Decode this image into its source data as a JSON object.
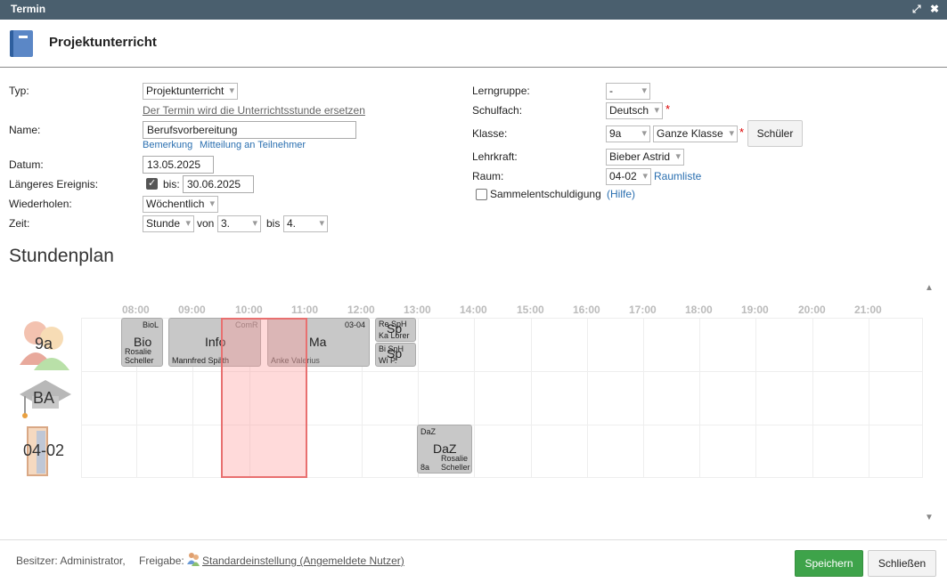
{
  "window": {
    "title": "Termin"
  },
  "header": {
    "title": "Projektunterricht"
  },
  "form": {
    "typ_label": "Typ:",
    "typ_value": "Projektunterricht",
    "typ_note": "Der Termin wird die Unterrichtsstunde ersetzen",
    "name_label": "Name:",
    "name_value": "Berufsvorbereitung",
    "bemerkung_link": "Bemerkung",
    "mitteilung_link": "Mitteilung an Teilnehmer",
    "datum_label": "Datum:",
    "datum_value": "13.05.2025",
    "laenger_label": "Längeres Ereignis:",
    "bis_label": "bis:",
    "bis_value": "30.06.2025",
    "wiederholen_label": "Wiederholen:",
    "wiederholen_value": "Wöchentlich",
    "zeit_label": "Zeit:",
    "zeit_unit": "Stunde",
    "von_label": "von",
    "von_value": "3.",
    "bis2_label": "bis",
    "bis2_value": "4.",
    "lerngruppe_label": "Lerngruppe:",
    "lerngruppe_value": "-",
    "schulfach_label": "Schulfach:",
    "schulfach_value": "Deutsch",
    "klasse_label": "Klasse:",
    "klasse_value": "9a",
    "klasse_scope": "Ganze Klasse",
    "schueler_button": "Schüler",
    "lehrkraft_label": "Lehrkraft:",
    "lehrkraft_value": "Bieber Astrid",
    "raum_label": "Raum:",
    "raum_value": "04-02",
    "raumliste_link": "Raumliste",
    "sammel_label": "Sammelentschuldigung",
    "hilfe_link": "(Hilfe)",
    "required_mark": "*"
  },
  "stundenplan": {
    "title": "Stundenplan",
    "hours": [
      "08:00",
      "09:00",
      "10:00",
      "11:00",
      "12:00",
      "13:00",
      "14:00",
      "15:00",
      "16:00",
      "17:00",
      "18:00",
      "19:00",
      "20:00",
      "21:00"
    ],
    "rows": [
      "9a",
      "BA",
      "04-02"
    ],
    "blocks": {
      "bio": {
        "code": "BioL",
        "subject": "Bio",
        "teacher1": "Rosalie",
        "teacher2": "Scheller"
      },
      "info": {
        "subject": "Info",
        "teacher": "Mannfred Späth",
        "room": "ComR"
      },
      "ma": {
        "subject": "Ma",
        "teacher": "Anke Valerius",
        "room": "03-04"
      },
      "sp1": {
        "subject": "Sp",
        "top": "Re  SpH",
        "bottom": "Ka  Lorer"
      },
      "sp2": {
        "subject": "Sp",
        "top": "Bi  SpH",
        "bottom": "Wi   P."
      },
      "daz": {
        "code": "DaZ",
        "subject": "DaZ",
        "klasse": "8a",
        "teacher1": "Rosalie",
        "teacher2": "Scheller"
      }
    }
  },
  "footer": {
    "besitzer": "Besitzer: Administrator,",
    "freigabe_label": "Freigabe:",
    "freigabe_value": "Standardeinstellung (Angemeldete Nutzer)",
    "save_button": "Speichern",
    "close_button": "Schließen"
  }
}
